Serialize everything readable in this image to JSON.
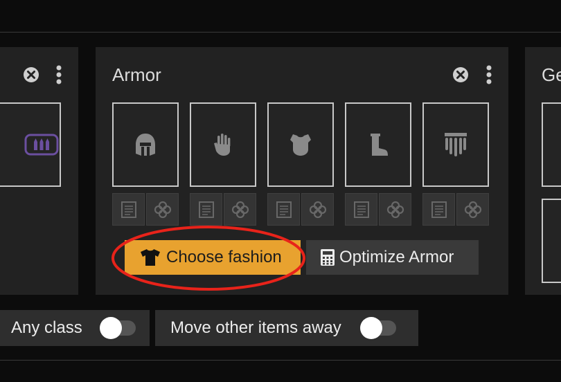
{
  "armor_card": {
    "title": "Armor",
    "choose_fashion_label": "Choose fashion",
    "optimize_label": "Optimize Armor"
  },
  "right_card": {
    "title_partial": "Ge"
  },
  "filters": {
    "any_class_label": "Any class",
    "any_class_on": false,
    "move_items_label": "Move other items away",
    "move_items_on": false
  },
  "highlight_color": "#e8231a",
  "accent_color": "#e8a22f"
}
